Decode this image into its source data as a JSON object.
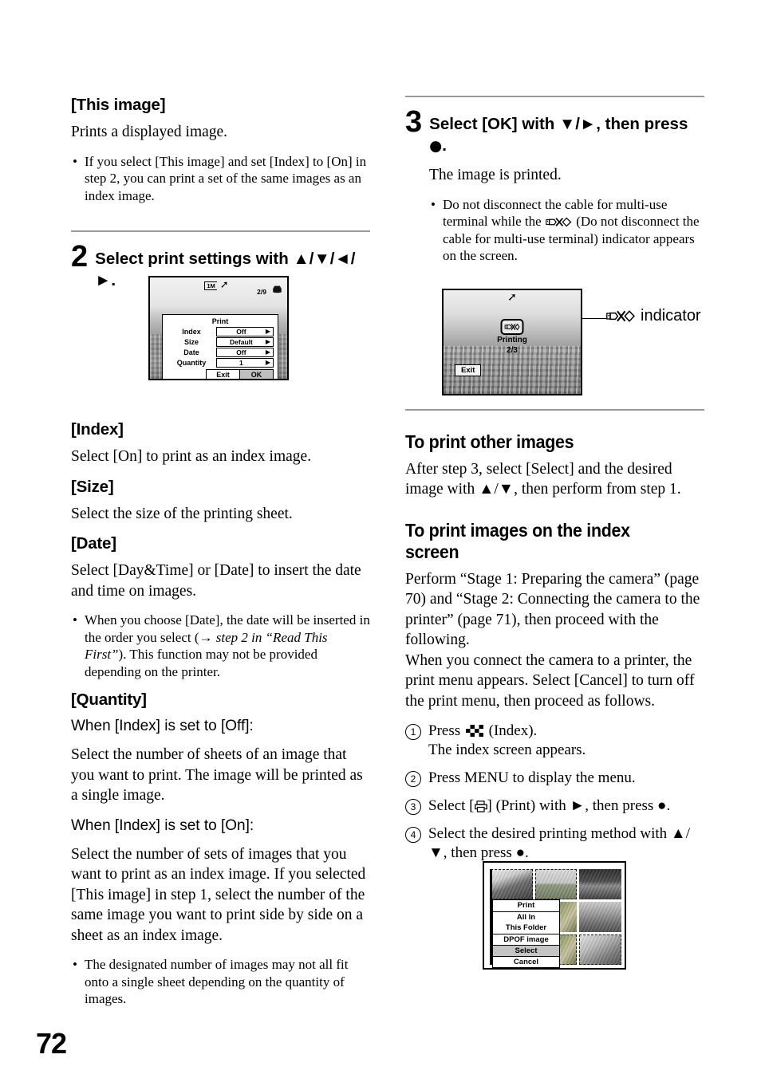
{
  "page": {
    "number": "72"
  },
  "left_column": {
    "this_image_heading": "[This image]",
    "this_image_body": "Prints a displayed image.",
    "this_image_bullet": "If you select [This image] and set [Index] to [On] in step 2, you can print a set of the same images as an index image.",
    "step2": {
      "number": "2",
      "text": "Select print settings with ▲/▼/◄/►."
    },
    "index_heading": "[Index]",
    "index_body": "Select [On] to print as an index image.",
    "size_heading": "[Size]",
    "size_body": "Select the size of the printing sheet.",
    "date_heading": "[Date]",
    "date_body": "Select [Day&Time] or [Date] to insert the date and time on images.",
    "date_bullet_part1": "When you choose [Date], the date will be inserted in the order you select (→ ",
    "date_bullet_italic1": "step 2 in “Read This First”",
    "date_bullet_part2": "). This function may not be provided depending on the printer.",
    "quantity_heading": "[Quantity]",
    "quantity_off_label": "When [Index] is set to [Off]:",
    "quantity_off_body": "Select the number of sheets of an image that you want to print. The image will be printed as a single image.",
    "quantity_on_label": "When [Index] is set to [On]:",
    "quantity_on_body": "Select the number of sets of images that you want to print as an index image. If you selected [This image] in step 1, select the number of the same image you want to print side by side on a sheet as an index image.",
    "quantity_bullet": "The designated number of images may not all fit onto a single sheet depending on the quantity of images."
  },
  "camera_screen_step2": {
    "resolution_icon": "1M",
    "shake_icon": "camera-shake-icon",
    "counter": "2/9",
    "printer_icon": "printer-icon",
    "dialog_title": "Print",
    "rows": [
      {
        "label": "Index",
        "value": "Off"
      },
      {
        "label": "Size",
        "value": "Default"
      },
      {
        "label": "Date",
        "value": "Off"
      },
      {
        "label": "Quantity",
        "value": "1"
      }
    ],
    "exit_button": "Exit",
    "ok_button": "OK"
  },
  "right_column": {
    "step3": {
      "number": "3",
      "text_part1": "Select [OK] with ▼/►, then press ",
      "text_dot": "●",
      "text_part2": "."
    },
    "step3_body": "The image is printed.",
    "step3_bullet_part1": "Do not disconnect the cable for multi-use terminal while the ",
    "step3_bullet_part2": " (Do not disconnect the cable for multi-use terminal) indicator appears on the screen.",
    "indicator_callout": "indicator",
    "print_other_heading": "To print other images",
    "print_other_body": "After step 3, select [Select] and the desired image with ▲/▼, then perform from step 1.",
    "print_index_heading": "To print images on the index screen",
    "print_index_body1": "Perform “Stage 1: Preparing the camera” (page 70) and “Stage 2: Connecting the camera to the printer” (page 71), then proceed with the following.",
    "print_index_body2": "When you connect the camera to a printer, the print menu appears. Select [Cancel] to turn off the print menu, then proceed as follows.",
    "steps": [
      {
        "num": "1",
        "text_before": "Press ",
        "icon": "index-icon",
        "text_after": " (Index).",
        "subtext": "The index screen appears."
      },
      {
        "num": "2",
        "text_before": "Press MENU to display the menu.",
        "icon": "",
        "text_after": "",
        "subtext": ""
      },
      {
        "num": "3",
        "text_before": "Select [",
        "icon": "print-icon",
        "text_after": "] (Print) with ►, then press ●.",
        "subtext": ""
      },
      {
        "num": "4",
        "text_before": "Select the desired printing method with ▲/▼, then press ●.",
        "icon": "",
        "text_after": "",
        "subtext": ""
      }
    ]
  },
  "camera_screen_step3": {
    "shake_icon": "camera-shake-icon",
    "indicator_icon": "do-not-disconnect-icon",
    "printing_label": "Printing",
    "printing_counter": "2/3",
    "exit_button": "Exit"
  },
  "index_screen": {
    "menu_title": "Print",
    "menu_items": [
      {
        "label": "All In\nThis Folder",
        "selected": false
      },
      {
        "label": "DPOF image",
        "selected": false
      },
      {
        "label": "Select",
        "selected": true
      },
      {
        "label": "Cancel",
        "selected": false
      }
    ]
  },
  "colors": {
    "rule": "#9a9a9a",
    "selected_row": "#bfbfbf",
    "text": "#000000",
    "background": "#ffffff"
  }
}
